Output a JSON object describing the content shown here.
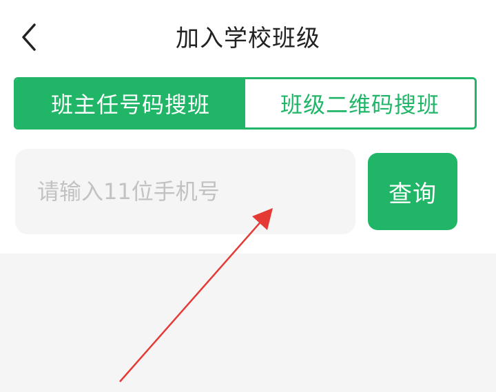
{
  "header": {
    "title": "加入学校班级",
    "back_icon": "chevron-left-icon"
  },
  "tabs": [
    {
      "label": "班主任号码搜班",
      "active": true
    },
    {
      "label": "班级二维码搜班",
      "active": false
    }
  ],
  "search": {
    "placeholder": "请输入11位手机号",
    "value": "",
    "button_label": "查询"
  },
  "colors": {
    "accent": "#21b568",
    "background": "#f5f5f5",
    "annotation_arrow": "#e53935"
  }
}
